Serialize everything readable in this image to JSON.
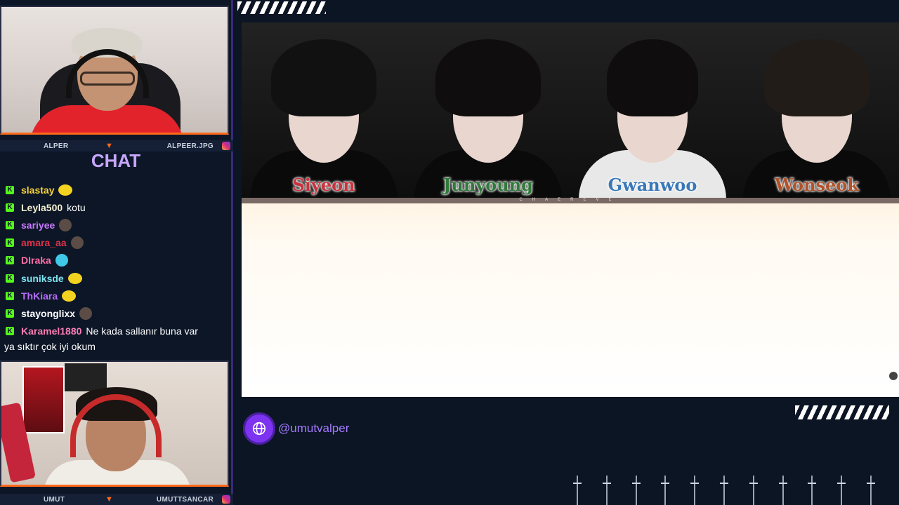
{
  "webcams": {
    "top": {
      "name_left": "ALPER",
      "name_right": "ALPEER.JPG"
    },
    "bottom": {
      "name_left": "UMUT",
      "name_right": "UMUTTSANCAR"
    }
  },
  "chat": {
    "title": "CHAT",
    "messages": [
      {
        "user": "slastay",
        "color": "#f7d13b",
        "text": "",
        "emote": "blob"
      },
      {
        "user": "Leyla500",
        "color": "#f5f0d2",
        "text": "kotu",
        "emote": ""
      },
      {
        "user": "sariyee",
        "color": "#c978ff",
        "text": "",
        "emote": "person"
      },
      {
        "user": "amara_aa",
        "color": "#e0324a",
        "text": "",
        "emote": "person"
      },
      {
        "user": "DIraka",
        "color": "#ff6fa8",
        "text": "",
        "emote": "cyan"
      },
      {
        "user": "suniksde",
        "color": "#7ee3f0",
        "text": "",
        "emote": "blob"
      },
      {
        "user": "ThKiara",
        "color": "#b66dff",
        "text": "",
        "emote": "blob"
      },
      {
        "user": "stayonglixx",
        "color": "#ffffff",
        "text": "",
        "emote": "person"
      },
      {
        "user": "Karamel1880",
        "color": "#ff7db6",
        "text": "Ne kada sallanır buna var",
        "emote": ""
      }
    ],
    "wrap_text": "ya sıktır çok iyi okum"
  },
  "members": [
    {
      "name": "Siyeon",
      "color": "#c8343e"
    },
    {
      "name": "Junyoung",
      "color": "#2f7a3a"
    },
    {
      "name": "Gwanwoo",
      "color": "#3a78b8"
    },
    {
      "name": "Wonseok",
      "color": "#b0522a"
    }
  ],
  "strip_caption": "CHAEREVE",
  "social": {
    "handle": "@umutvalper",
    "icon": "globe-icon"
  },
  "colors": {
    "accent": "#7d34f0",
    "orange": "#ff6a1a",
    "kick": "#53fc18"
  }
}
